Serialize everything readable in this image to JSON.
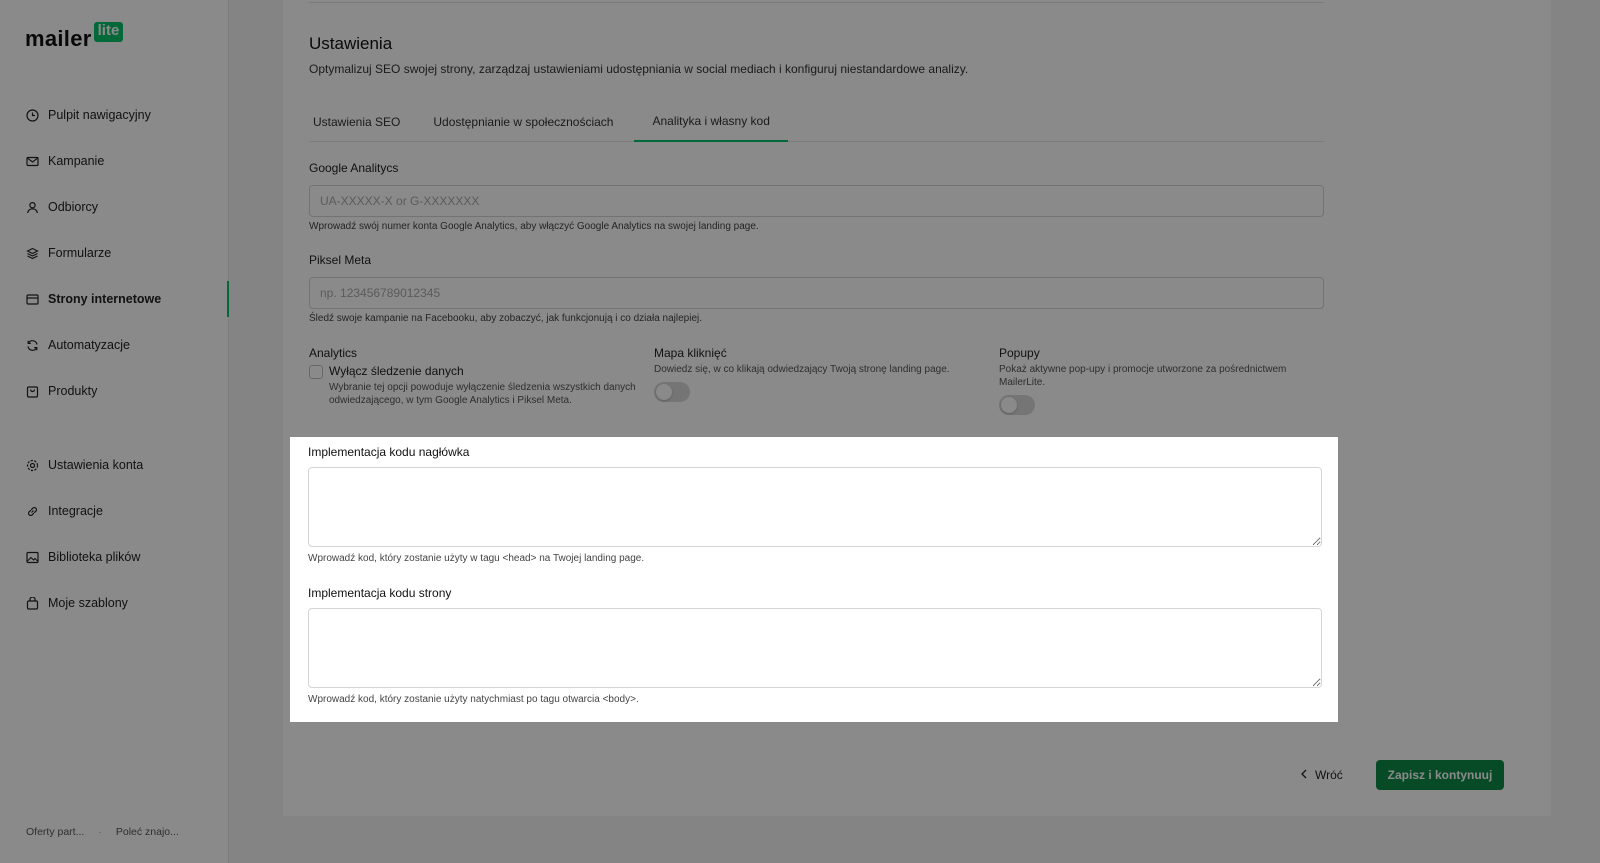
{
  "brand": {
    "name": "mailer",
    "badge": "lite",
    "accent": "#09c269",
    "primary_button": "#0d8a47"
  },
  "sidebar": {
    "items": [
      {
        "label": "Pulpit nawigacyjny",
        "icon": "dashboard-icon"
      },
      {
        "label": "Kampanie",
        "icon": "mail-icon"
      },
      {
        "label": "Odbiorcy",
        "icon": "user-icon"
      },
      {
        "label": "Formularze",
        "icon": "layers-icon"
      },
      {
        "label": "Strony internetowe",
        "icon": "browser-icon",
        "active": true
      },
      {
        "label": "Automatyzacje",
        "icon": "refresh-icon"
      },
      {
        "label": "Produkty",
        "icon": "bag-icon"
      }
    ],
    "items_bottom": [
      {
        "label": "Ustawienia konta",
        "icon": "gear-icon"
      },
      {
        "label": "Integracje",
        "icon": "link-icon"
      },
      {
        "label": "Biblioteka plików",
        "icon": "image-icon"
      },
      {
        "label": "Moje szablony",
        "icon": "template-icon"
      }
    ],
    "footer": {
      "partners": "Oferty part...",
      "separator": "·",
      "refer": "Poleć znajo..."
    }
  },
  "settings": {
    "title": "Ustawienia",
    "description": "Optymalizuj SEO swojej strony, zarządzaj ustawieniami udostępniania w social mediach i konfiguruj niestandardowe analizy.",
    "tabs": [
      "Ustawienia SEO",
      "Udostępnianie w społecznościach",
      "Analityka i własny kod"
    ],
    "active_tab": "Analityka i własny kod"
  },
  "ga": {
    "label": "Google Analitycs",
    "placeholder": "UA-XXXXX-X or G-XXXXXXX",
    "value": "",
    "hint": "Wprowadź swój numer konta Google Analytics, aby włączyć Google Analytics na swojej landing page."
  },
  "meta": {
    "label": "Piksel Meta",
    "placeholder": "np. 123456789012345",
    "value": "",
    "hint": "Śledź swoje kampanie na Facebooku, aby zobaczyć, jak funkcjonują i co działa najlepiej."
  },
  "analytics": {
    "title": "Analytics",
    "checkbox_label": "Wyłącz śledzenie danych",
    "checkbox_text": "Wybranie tej opcji powoduje wyłączenie śledzenia wszystkich danych odwiedzającego, w tym Google Analytics i Piksel Meta.",
    "checked": false
  },
  "heatmap": {
    "title": "Mapa kliknięć",
    "text": "Dowiedz się, w co klikają odwiedzający Twoją stronę landing page.",
    "enabled": false
  },
  "popups": {
    "title": "Popupy",
    "text": "Pokaż aktywne pop-upy i promocje utworzone za pośrednictwem MailerLite.",
    "enabled": false
  },
  "head_code": {
    "label": "Implementacja kodu nagłówka",
    "value": "",
    "hint": "Wprowadź kod, który zostanie użyty w tagu <head> na Twojej landing page."
  },
  "body_code": {
    "label": "Implementacja kodu strony",
    "value": "",
    "hint": "Wprowadź kod, który zostanie użyty natychmiast po tagu otwarcia <body>."
  },
  "actions": {
    "back": "Wróć",
    "save": "Zapisz i kontynuuj"
  }
}
